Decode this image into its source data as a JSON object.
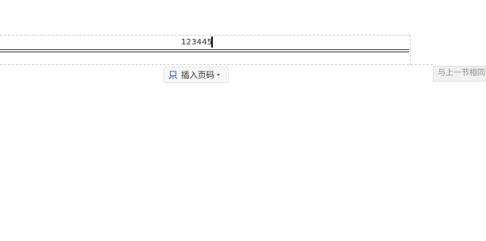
{
  "header": {
    "text": "123445",
    "insert_page_number_label": "插入页码",
    "link_to_previous_label": "与上一节相同"
  },
  "icons": {
    "insert_page_number": "page-number-icon",
    "dropdown": "chevron-down-icon"
  },
  "colors": {
    "accent": "#3a5fb0",
    "dashed_border": "#c8c8c8"
  }
}
